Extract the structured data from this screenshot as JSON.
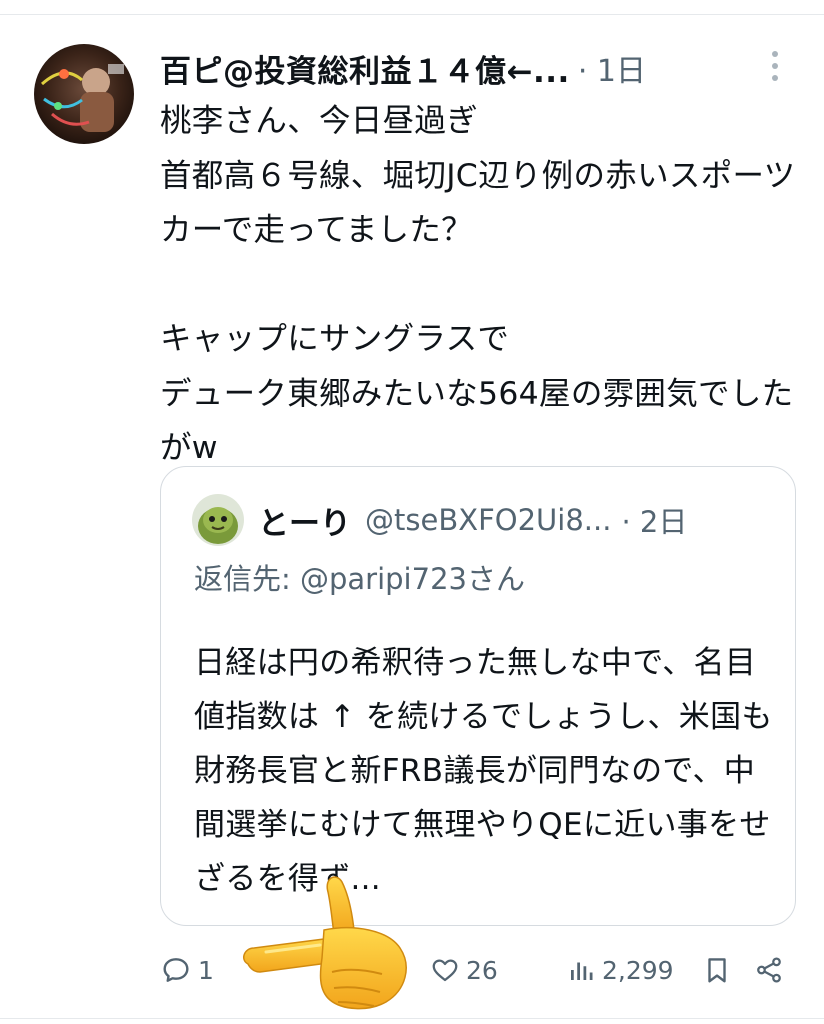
{
  "post": {
    "author_name": "百ピ@投資総利益１４億←...",
    "time": "· 1日",
    "text": "桃李さん、今日昼過ぎ\n首都高６号線、堀切JC辺り例の赤いスポーツカーで走ってました？\n\nキャップにサングラスで\nデューク東郷みたいな564屋の雰囲気でしたがw"
  },
  "quote": {
    "author_name": "とーり",
    "handle": "@tseBXFO2Ui8...",
    "time": "· 2日",
    "reply_to": "返信先: @paripi723さん",
    "text": "日経は円の希釈待った無しな中で、名目値指数は ↑ を続けるでしょうし、米国も財務長官と新FRB議長が同門なので、中間選挙にむけて無理やりQEに近い事をせざるを得ず..."
  },
  "actions": {
    "replies": "1",
    "likes": "26",
    "views": "2,299"
  },
  "icons": {
    "more": "more-vertical-icon",
    "reply": "reply-icon",
    "like": "heart-icon",
    "views": "views-icon",
    "bookmark": "bookmark-icon",
    "share": "share-icon",
    "pointer": "pointing-hand-icon"
  },
  "colors": {
    "text": "#0f1419",
    "secondary": "#536471",
    "border": "#d6dbe0"
  }
}
